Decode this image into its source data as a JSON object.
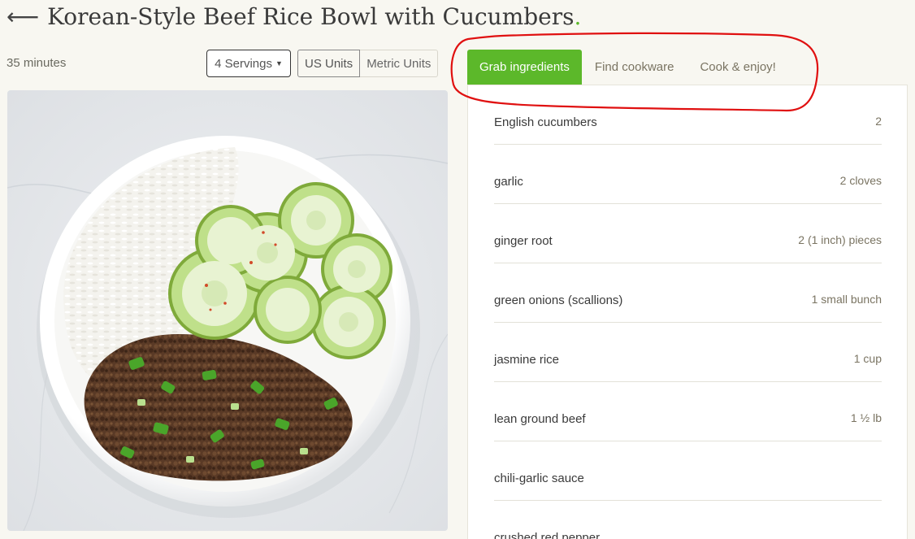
{
  "header": {
    "back_icon": "left-arrow-icon",
    "title": "Korean-Style Beef Rice Bowl with Cucumbers",
    "title_dot": ".",
    "accent_color": "#5cb82a"
  },
  "meta": {
    "time": "35 minutes",
    "servings_label": "4 Servings",
    "units": {
      "us": "US Units",
      "metric": "Metric Units",
      "selected": "US Units"
    }
  },
  "tabs": [
    {
      "label": "Grab ingredients",
      "active": true
    },
    {
      "label": "Find cookware",
      "active": false
    },
    {
      "label": "Cook & enjoy!",
      "active": false
    }
  ],
  "ingredients": [
    {
      "name": "English cucumbers",
      "qty": "2"
    },
    {
      "name": "garlic",
      "qty": "2 cloves"
    },
    {
      "name": "ginger root",
      "qty": "2 (1 inch) pieces"
    },
    {
      "name": "green onions (scallions)",
      "qty": "1 small bunch"
    },
    {
      "name": "jasmine rice",
      "qty": "1 cup"
    },
    {
      "name": "lean ground beef",
      "qty": "1 ½ lb"
    },
    {
      "name": "chili-garlic sauce",
      "qty": ""
    },
    {
      "name": "crushed red pepper",
      "qty": ""
    }
  ],
  "annotation": {
    "color": "#e01010",
    "shape": "hand-drawn circle around tabs"
  }
}
